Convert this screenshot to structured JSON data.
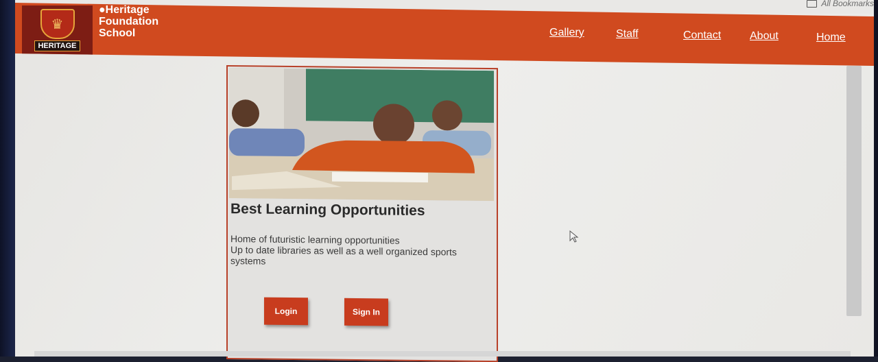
{
  "browser": {
    "bookmarks_label": "All Bookmarks"
  },
  "site": {
    "brand_lines": [
      "●Heritage",
      "Foundation",
      "School"
    ],
    "logo_text": "HERITAGE"
  },
  "nav": {
    "gallery": "Gallery",
    "staff": "Staff",
    "contact": "Contact",
    "about": "About",
    "home": "Home"
  },
  "card": {
    "title": "Best Learning Opportunities",
    "lines": [
      "Home of futuristic learning opportunities",
      "Up to date libraries as well as a well organized sports",
      "systems"
    ],
    "login_label": "Login",
    "signin_label": "Sign In"
  },
  "colors": {
    "brand": "#d04a1f",
    "button": "#c83c1e"
  }
}
